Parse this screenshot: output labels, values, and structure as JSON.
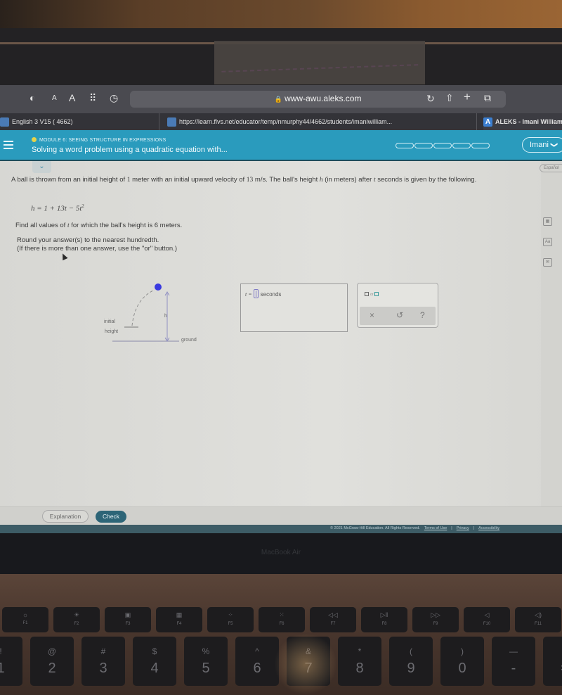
{
  "browser": {
    "url": "www-awu.aleks.com",
    "tabs": [
      {
        "label": "English 3 V15 ( 4662)"
      },
      {
        "label": "https://learn.flvs.net/educator/temp/nmurphy44/4662/students/imaniwilliam..."
      },
      {
        "label": "ALEKS - Imani Williams"
      }
    ],
    "toolbar_icons": [
      "shield-icon",
      "text-smaller-icon",
      "text-larger-icon",
      "grid-icon",
      "history-icon",
      "reload-icon",
      "share-icon",
      "new-tab-icon",
      "tabs-icon"
    ],
    "toolbar_glyphs": {
      "shield": "◐",
      "text_small": "A",
      "text_large": "A",
      "grid": "⠿",
      "history": "◷",
      "reload": "↻",
      "share": "⇧",
      "plus": "+",
      "tabs": "⧉",
      "lock": "🔒"
    }
  },
  "header": {
    "module": "MODULE 6: SEEING STRUCTURE IN EXPRESSIONS",
    "topic": "Solving a word problem using a quadratic equation with...",
    "progress_segments": 5,
    "progress_filled": 0,
    "user": "Imani",
    "user_chevron": "❯",
    "colors": {
      "header_bg": "#2a9bbd",
      "check_button": "#2d6577",
      "module_dot": "#e5d34a"
    }
  },
  "side": {
    "language": "Español",
    "collapse_glyph": "⌄",
    "icons": [
      {
        "name": "calculator-icon",
        "glyph": "▦"
      },
      {
        "name": "dictionary-icon",
        "glyph": "Aa"
      },
      {
        "name": "message-icon",
        "glyph": "✉"
      }
    ]
  },
  "problem": {
    "text_before_13": "A ball is thrown from an initial height of ",
    "initial_height": "1",
    "text_mid1": " meter with an initial upward velocity of ",
    "velocity": "13",
    "text_mid2": "  m/s. The ball's height ",
    "var_h": "h",
    "text_mid3": " (in meters) after ",
    "var_t": "t",
    "text_end": " seconds is given by the following.",
    "formula_main": "h = 1 + 13t − 5t",
    "formula_exp": "2",
    "find_before": "Find all values of ",
    "find_var": "t",
    "find_after": " for which the ball's height is 6 meters.",
    "round_line1": "Round your answer(s) to the nearest hundredth.",
    "round_line2": "(If there is more than one answer, use the \"or\" button.)"
  },
  "diagram": {
    "label_initial": "initial",
    "label_height": "height",
    "label_h": "h",
    "label_ground": "ground",
    "ball_color": "#3a3ae0"
  },
  "answer": {
    "prefix": "t =",
    "unit": "seconds",
    "value": ""
  },
  "keypad": {
    "or_label": "or",
    "clear": "×",
    "undo": "↺",
    "help": "?"
  },
  "footer": {
    "explanation": "Explanation",
    "check": "Check",
    "copyright": "© 2021 McGraw-Hill Education. All Rights Reserved.",
    "terms": "Terms of Use",
    "privacy": "Privacy",
    "accessibility": "Accessibility",
    "sep": "|"
  },
  "laptop": {
    "brand": "MacBook Air",
    "fkeys": [
      {
        "icon": "☼",
        "label": "F1"
      },
      {
        "icon": "☀",
        "label": "F2"
      },
      {
        "icon": "▣",
        "label": "F3"
      },
      {
        "icon": "▦",
        "label": "F4"
      },
      {
        "icon": "⁘",
        "label": "F5"
      },
      {
        "icon": "⁙",
        "label": "F6"
      },
      {
        "icon": "◁◁",
        "label": "F7"
      },
      {
        "icon": "▷‖",
        "label": "F8"
      },
      {
        "icon": "▷▷",
        "label": "F9"
      },
      {
        "icon": "◁",
        "label": "F10"
      },
      {
        "icon": "◁)",
        "label": "F11"
      }
    ],
    "numkeys": [
      {
        "sym": "!",
        "num": "1"
      },
      {
        "sym": "@",
        "num": "2"
      },
      {
        "sym": "#",
        "num": "3"
      },
      {
        "sym": "$",
        "num": "4"
      },
      {
        "sym": "%",
        "num": "5"
      },
      {
        "sym": "^",
        "num": "6"
      },
      {
        "sym": "&",
        "num": "7"
      },
      {
        "sym": "*",
        "num": "8"
      },
      {
        "sym": "(",
        "num": "9"
      },
      {
        "sym": ")",
        "num": "0"
      },
      {
        "sym": "—",
        "num": "-"
      },
      {
        "sym": "+",
        "num": "="
      }
    ]
  }
}
